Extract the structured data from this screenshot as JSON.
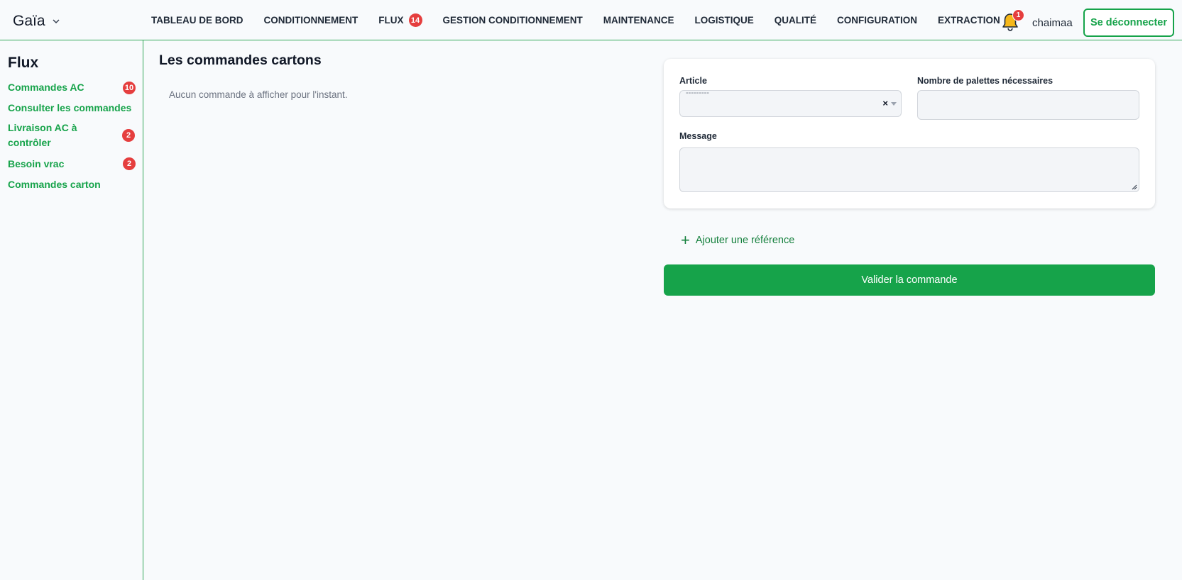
{
  "brand": {
    "name": "Gaïa",
    "menu_icon": "chevron-down-icon"
  },
  "nav": {
    "items": [
      {
        "label": "TABLEAU DE BORD"
      },
      {
        "label": "CONDITIONNEMENT"
      },
      {
        "label": "FLUX",
        "badge": "14"
      },
      {
        "label": "GESTION CONDITIONNEMENT"
      },
      {
        "label": "MAINTENANCE"
      },
      {
        "label": "LOGISTIQUE"
      },
      {
        "label": "QUALITÉ"
      },
      {
        "label": "CONFIGURATION"
      },
      {
        "label": "EXTRACTION"
      }
    ]
  },
  "header": {
    "notifications": {
      "icon": "bell-icon",
      "count": "1",
      "color": "#f6b81a"
    },
    "username": "chaimaa",
    "logout_label": "Se déconnecter"
  },
  "sidebar": {
    "title": "Flux",
    "items": [
      {
        "label": "Commandes AC",
        "badge": "10"
      },
      {
        "label": "Consulter les commandes"
      },
      {
        "label": "Livraison AC à contrôler",
        "badge": "2"
      },
      {
        "label": "Besoin vrac",
        "badge": "2"
      },
      {
        "label": "Commandes carton"
      }
    ]
  },
  "main": {
    "title": "Les commandes cartons",
    "empty_message": "Aucun commande à afficher pour l'instant."
  },
  "form": {
    "article_label": "Article",
    "article_placeholder": "---------",
    "article_clear": "×",
    "palettes_label": "Nombre de palettes nécessaires",
    "palettes_value": "",
    "message_label": "Message",
    "message_value": "",
    "add_reference_label": "Ajouter une référence",
    "validate_label": "Valider la commande"
  },
  "colors": {
    "accent": "#16a34a",
    "badge": "#e53e3e",
    "background": "#f8fafc"
  }
}
